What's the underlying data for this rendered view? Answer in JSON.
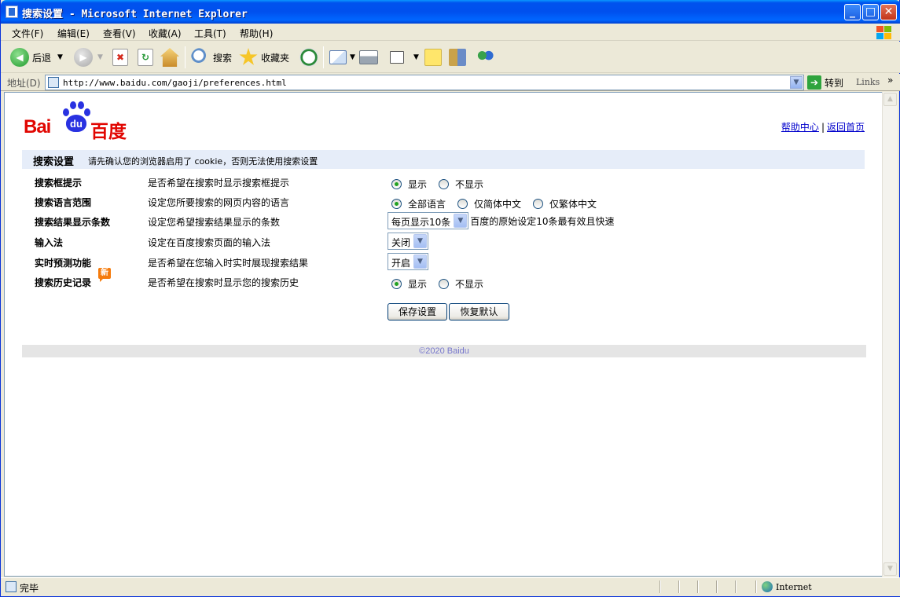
{
  "window": {
    "title": "搜索设置 - Microsoft Internet Explorer",
    "min_label": "_",
    "max_label": "□",
    "close_label": "✕"
  },
  "menu": {
    "items": [
      "文件(F)",
      "编辑(E)",
      "查看(V)",
      "收藏(A)",
      "工具(T)",
      "帮助(H)"
    ]
  },
  "toolbar": {
    "back_label": "后退",
    "search_label": "搜索",
    "favorites_label": "收藏夹"
  },
  "address": {
    "label": "地址(D)",
    "url": "http://www.baidu.com/gaoji/preferences.html",
    "go_label": "转到",
    "links_label": "Links",
    "chevron": "»"
  },
  "page": {
    "logo_latin": "Bai",
    "logo_paw": "du",
    "logo_cn": "百度",
    "help_link": "帮助中心",
    "separator": "|",
    "home_link": "返回首页",
    "header_title": "搜索设置",
    "header_note": "请先确认您的浏览器启用了 cookie，否则无法使用搜索设置",
    "rows": [
      {
        "label": "搜索框提示",
        "desc": "是否希望在搜索时显示搜索框提示",
        "options": [
          "显示",
          "不显示"
        ],
        "selected": 0
      },
      {
        "label": "搜索语言范围",
        "desc": "设定您所要搜索的网页内容的语言",
        "options": [
          "全部语言",
          "仅简体中文",
          "仅繁体中文"
        ],
        "selected": 0
      },
      {
        "label": "搜索结果显示条数",
        "desc": "设定您希望搜索结果显示的条数",
        "select_value": "每页显示10条",
        "hint": "百度的原始设定10条最有效且快速"
      },
      {
        "label": "输入法",
        "desc": "设定在百度搜索页面的输入法",
        "select_value": "关闭"
      },
      {
        "label": "实时预测功能",
        "desc": "是否希望在您输入时实时展现搜索结果",
        "select_value": "开启"
      },
      {
        "label": "搜索历史记录",
        "badge": "新",
        "desc": "是否希望在搜索时显示您的搜索历史",
        "options": [
          "显示",
          "不显示"
        ],
        "selected": 0
      }
    ],
    "save_button": "保存设置",
    "reset_button": "恢复默认",
    "footer": "©2020 Baidu"
  },
  "status": {
    "text": "完毕",
    "zone": "Internet"
  },
  "colors": {
    "titlebar": "#0053ee",
    "logo_red": "#e10601",
    "logo_blue": "#2932e1",
    "header_bg": "#e6edf9",
    "link": "#0000cc",
    "radio_on": "#21a121"
  },
  "icons": [
    "back-icon",
    "forward-icon",
    "stop-icon",
    "refresh-icon",
    "home-icon",
    "search-icon",
    "favorites-icon",
    "history-icon",
    "mail-icon",
    "print-icon",
    "edit-icon",
    "discuss-icon",
    "research-icon",
    "messenger-icon",
    "ie-page-icon",
    "globe-icon"
  ]
}
